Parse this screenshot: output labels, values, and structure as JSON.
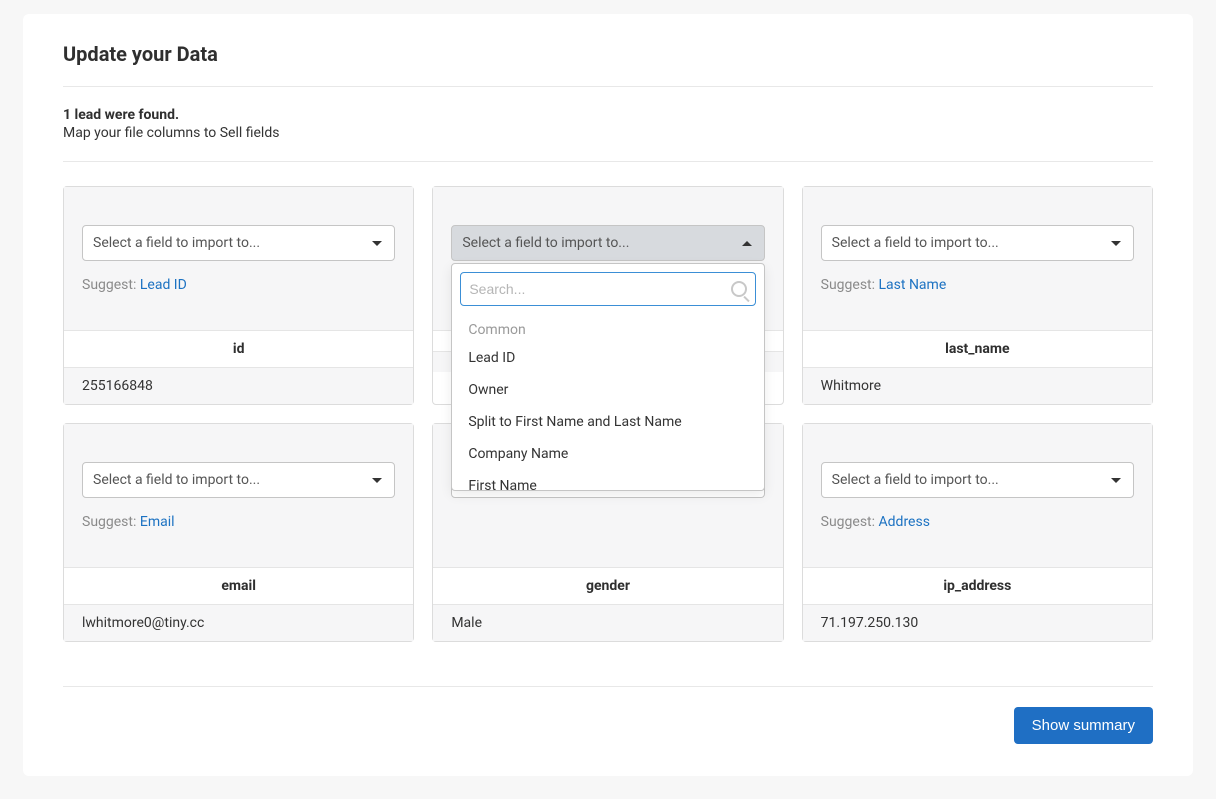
{
  "title": "Update your Data",
  "found_line": "1 lead were found.",
  "instruction": "Map your file columns to Sell fields",
  "select_placeholder": "Select a field to import to...",
  "suggest_label": "Suggest:",
  "cards": [
    {
      "suggest": "Lead ID",
      "column": "id",
      "value": "255166848",
      "dropdown_open": false
    },
    {
      "suggest": "",
      "column": "",
      "value": "",
      "dropdown_open": true
    },
    {
      "suggest": "Last Name",
      "column": "last_name",
      "value": "Whitmore",
      "dropdown_open": false
    },
    {
      "suggest": "Email",
      "column": "email",
      "value": "lwhitmore0@tiny.cc",
      "dropdown_open": false
    },
    {
      "suggest": "",
      "column": "gender",
      "value": "Male",
      "dropdown_open": false
    },
    {
      "suggest": "Address",
      "column": "ip_address",
      "value": "71.197.250.130",
      "dropdown_open": false
    }
  ],
  "dropdown": {
    "search_placeholder": "Search...",
    "section_label": "Common",
    "options": [
      "Lead ID",
      "Owner",
      "Split to First Name and Last Name",
      "Company Name",
      "First Name"
    ]
  },
  "footer_button": "Show summary"
}
